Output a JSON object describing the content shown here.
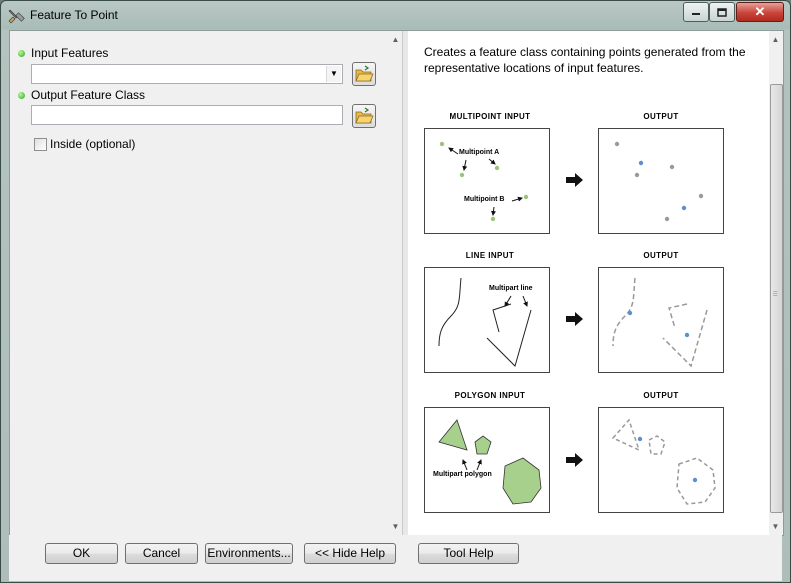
{
  "window": {
    "title": "Feature To Point"
  },
  "params": {
    "input_features": {
      "label": "Input Features",
      "value": ""
    },
    "output_feature_class": {
      "label": "Output Feature Class",
      "value": ""
    },
    "inside": {
      "label": "Inside (optional)",
      "checked": false
    }
  },
  "help": {
    "description": "Creates a feature class containing points generated from the representative locations of input features.",
    "rows": [
      {
        "input_label": "MULTIPOINT INPUT",
        "output_label": "OUTPUT",
        "annot1": "Multipoint A",
        "annot2": "Multipoint B"
      },
      {
        "input_label": "LINE INPUT",
        "output_label": "OUTPUT",
        "annot1": "Multipart line"
      },
      {
        "input_label": "POLYGON INPUT",
        "output_label": "OUTPUT",
        "annot1": "Multipart polygon"
      }
    ]
  },
  "buttons": {
    "ok": "OK",
    "cancel": "Cancel",
    "environments": "Environments...",
    "hide_help": "<< Hide Help",
    "tool_help": "Tool Help"
  },
  "colors": {
    "required_dot": "#2fa31d",
    "point_blue": "#5b8fd0",
    "point_gray": "#9a9a9a",
    "point_green": "#9bc47a",
    "polygon_fill": "#a8d08d"
  }
}
